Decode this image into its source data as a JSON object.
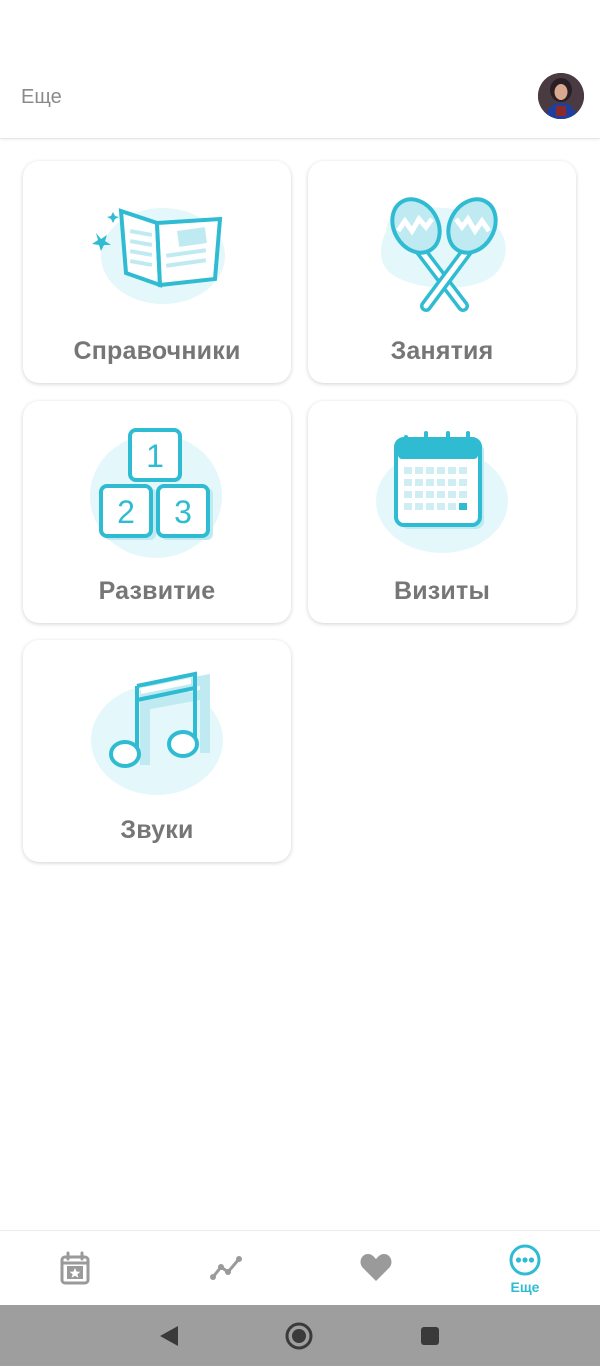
{
  "header": {
    "title": "Еще"
  },
  "cards": [
    {
      "label": "Справочники",
      "icon": "book-icon"
    },
    {
      "label": "Занятия",
      "icon": "maracas-icon"
    },
    {
      "label": "Развитие",
      "icon": "number-blocks-icon"
    },
    {
      "label": "Визиты",
      "icon": "calendar-icon"
    },
    {
      "label": "Звуки",
      "icon": "music-note-icon"
    }
  ],
  "blocks": {
    "one": "1",
    "two": "2",
    "three": "3"
  },
  "bottom_nav": {
    "items": [
      {
        "icon": "calendar-star-icon",
        "label": ""
      },
      {
        "icon": "chart-line-icon",
        "label": ""
      },
      {
        "icon": "heart-icon",
        "label": ""
      },
      {
        "icon": "more-dots-icon",
        "label": "Еще",
        "active": true
      }
    ]
  },
  "colors": {
    "accent": "#2fbcd3",
    "icon_light": "#e4f7fb",
    "inactive_icon": "#9a9a9a",
    "label_gray": "#767676",
    "system_bar": "#9e9e9e"
  }
}
